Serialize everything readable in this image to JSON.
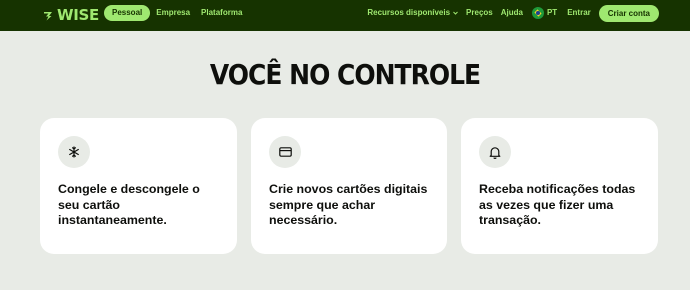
{
  "header": {
    "logo_text": "WISE",
    "tabs": [
      {
        "label": "Pessoal",
        "active": true
      },
      {
        "label": "Empresa",
        "active": false
      },
      {
        "label": "Plataforma",
        "active": false
      }
    ],
    "resources_label": "Recursos disponíveis",
    "prices_label": "Preços",
    "help_label": "Ajuda",
    "language_label": "PT",
    "login_label": "Entrar",
    "signup_label": "Criar conta"
  },
  "main": {
    "headline": "VOCÊ NO CONTROLE",
    "cards": [
      {
        "icon": "snowflake-icon",
        "text": "Congele e descongele o seu cartão instantaneamente."
      },
      {
        "icon": "card-icon",
        "text": "Crie novos cartões digitais sempre que achar necessário."
      },
      {
        "icon": "bell-icon",
        "text": "Receba notificações todas as vezes que fizer uma transação."
      }
    ]
  },
  "colors": {
    "brand_dark": "#163300",
    "brand_green": "#9fe870",
    "page_bg": "#e8ebe6",
    "card_bg": "#ffffff"
  }
}
